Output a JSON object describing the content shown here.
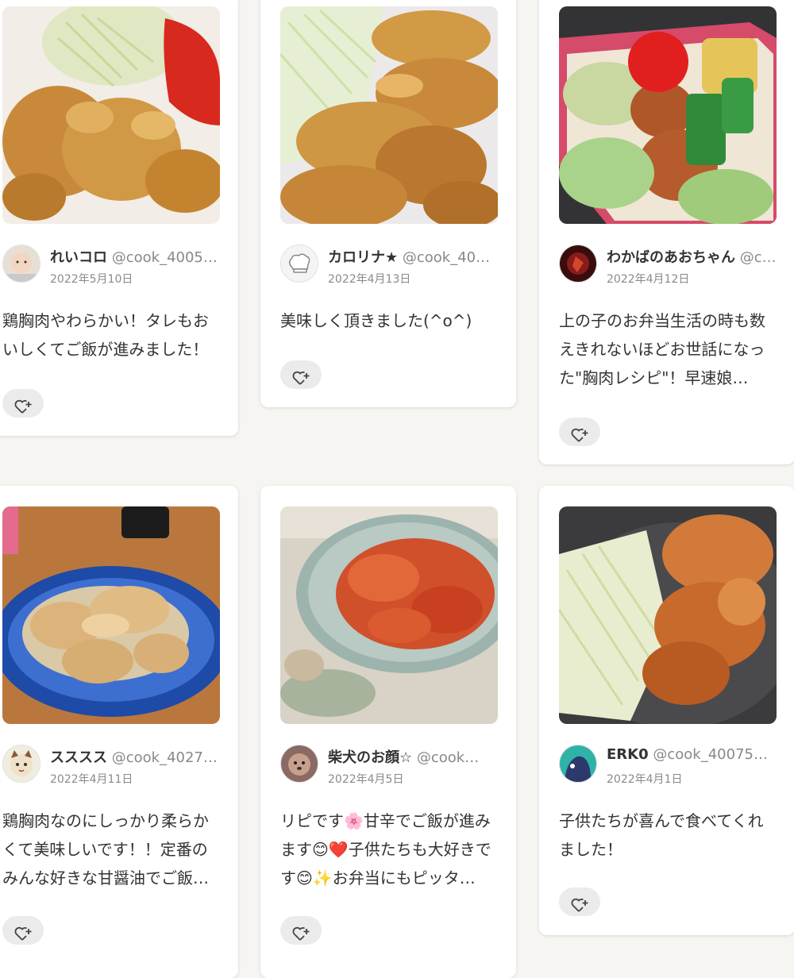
{
  "posts": [
    {
      "user": "れいコロ",
      "handle": "@cook_4005…",
      "date": "2022年5月10日",
      "comment": "鶏胸肉やわらかい！タレもおいしくてご飯が進みました！",
      "photo": "fried-chicken-cabbage-tomato-photo",
      "avatar": "baby-avatar"
    },
    {
      "user": "カロリナ★",
      "handle": "@cook_40…",
      "date": "2022年4月13日",
      "comment": "美味しく頂きました(^o^)",
      "photo": "glazed-chicken-cabbage-photo",
      "avatar": "chef-hat-avatar"
    },
    {
      "user": "わかばのあおちゃん",
      "handle": "@c…",
      "date": "2022年4月12日",
      "comment": "上の子のお弁当生活の時も数えきれないほどお世話になった\"胸肉レシピ\"！早速娘…",
      "photo": "bento-box-photo",
      "avatar": "dark-red-avatar"
    },
    {
      "user": "スススス",
      "handle": "@cook_4027…",
      "date": "2022年4月11日",
      "comment": "鶏胸肉なのにしっかり柔らかくて美味しいです！！定番のみんな好きな甘醤油でご飯進…",
      "photo": "chicken-blue-plate-photo",
      "avatar": "cat-avatar"
    },
    {
      "user": "柴犬のお顔☆",
      "handle": "@cook…",
      "date": "2022年4月5日",
      "comment": "リピです🌸甘辛でご飯が進みます😊❤️子供たちも大好きです😊✨お弁当にもピッタ…",
      "photo": "red-chicken-bowl-photo",
      "avatar": "dog-avatar"
    },
    {
      "user": "ERK0",
      "handle": "@cook_40075…",
      "date": "2022年4月1日",
      "comment": "子供たちが喜んで食べてくれました！",
      "photo": "chicken-dark-plate-photo",
      "avatar": "teal-avatar"
    }
  ]
}
